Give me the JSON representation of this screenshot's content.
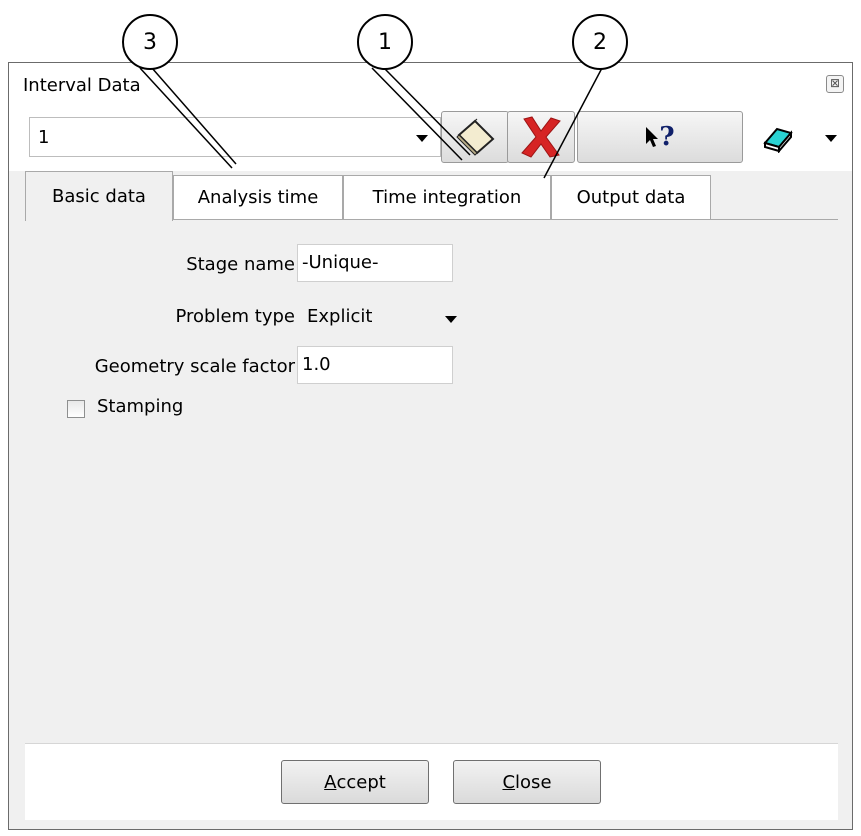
{
  "callouts": [
    "3",
    "1",
    "2"
  ],
  "window": {
    "title": "Interval Data",
    "close_glyph": "⊠"
  },
  "toolbar": {
    "interval_value": "1",
    "new_icon": "new-document-icon",
    "delete_icon": "delete-red-x-icon",
    "help_icon": "whats-this-help-icon",
    "help_text": "?",
    "menu_icon": "eraser-icon"
  },
  "tabs": [
    "Basic data",
    "Analysis time",
    "Time integration",
    "Output data"
  ],
  "form": {
    "stage_name_label": "Stage name",
    "stage_name_value": "-Unique-",
    "problem_type_label": "Problem type",
    "problem_type_value": "Explicit",
    "geometry_label": "Geometry scale factor",
    "geometry_value": "1.0",
    "stamping_label": "Stamping"
  },
  "footer": {
    "accept_first": "A",
    "accept_rest": "ccept",
    "close_first": "C",
    "close_rest": "lose"
  },
  "colors": {
    "delete_red": "#d62424",
    "eraser_cyan": "#2ad3d3"
  }
}
